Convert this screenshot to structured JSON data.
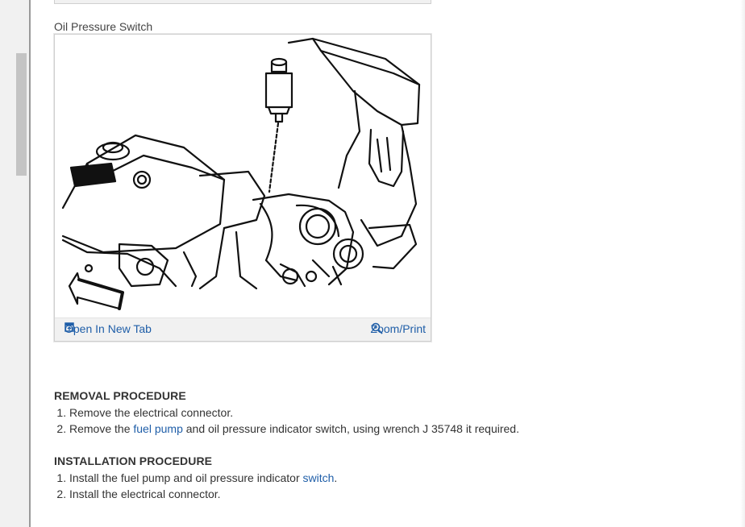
{
  "figure": {
    "caption": "Oil Pressure Switch",
    "open_tab_label": "Open In New Tab",
    "zoom_label": "Zoom/Print"
  },
  "removal": {
    "title": "REMOVAL PROCEDURE",
    "step1": "Remove the electrical connector.",
    "step2_pre": "Remove the ",
    "step2_link": "fuel pump",
    "step2_post": " and oil pressure indicator switch, using wrench J 35748 it required."
  },
  "installation": {
    "title": "INSTALLATION PROCEDURE",
    "step1_pre": "Install the fuel pump and oil pressure indicator ",
    "step1_link": "switch",
    "step1_post": ".",
    "step2": "Install the electrical connector."
  },
  "colors": {
    "link": "#1f5ea8",
    "toolbar_bg": "#f1f1f1"
  }
}
